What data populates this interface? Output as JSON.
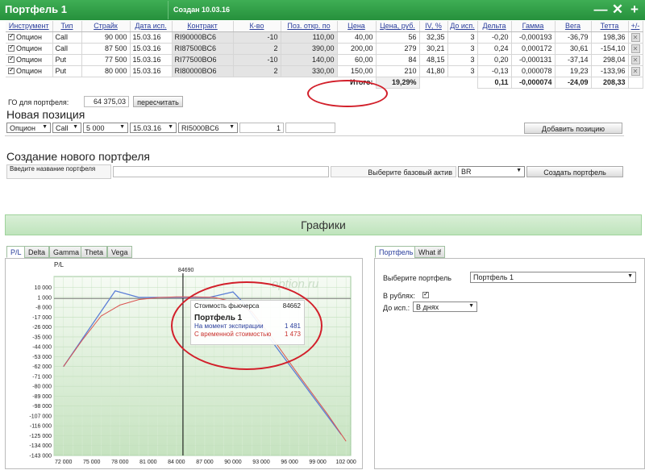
{
  "window": {
    "title": "Портфель 1",
    "created": "Создан 10.03.16",
    "minimize": "—",
    "close": "✕",
    "add": "+"
  },
  "positions_table": {
    "headers": [
      "Инструмент",
      "Тип",
      "Страйк",
      "Дата исп.",
      "Контракт",
      "К-во",
      "Поз. откр. по",
      "Цена",
      "Цена, руб.",
      "IV, %",
      "До исп.",
      "Дельта",
      "Гамма",
      "Вега",
      "Тетта",
      "+/-"
    ],
    "rows": [
      [
        "Опцион",
        "Call",
        "90 000",
        "15.03.16",
        "RI90000BC6",
        "-10",
        "110,00",
        "40,00",
        "56",
        "32,35",
        "3",
        "-0,20",
        "-0,000193",
        "-36,79",
        "198,36"
      ],
      [
        "Опцион",
        "Call",
        "87 500",
        "15.03.16",
        "RI87500BC6",
        "2",
        "390,00",
        "200,00",
        "279",
        "30,21",
        "3",
        "0,24",
        "0,000172",
        "30,61",
        "-154,10"
      ],
      [
        "Опцион",
        "Put",
        "77 500",
        "15.03.16",
        "RI77500BO6",
        "-10",
        "140,00",
        "60,00",
        "84",
        "48,15",
        "3",
        "0,20",
        "-0,000131",
        "-37,14",
        "298,04"
      ],
      [
        "Опцион",
        "Put",
        "80 000",
        "15.03.16",
        "RI80000BO6",
        "2",
        "330,00",
        "150,00",
        "210",
        "41,80",
        "3",
        "-0,13",
        "0,000078",
        "19,23",
        "-133,96"
      ]
    ],
    "totals": {
      "label": "Итого:",
      "percent": "19,29%",
      "delta": "0,11",
      "gamma": "-0,000074",
      "vega": "-24,09",
      "theta": "208,33"
    }
  },
  "go": {
    "label": "ГО для портфеля:",
    "value": "64 375,03",
    "recalc_button": "пересчитать"
  },
  "new_position": {
    "heading": "Новая позиция",
    "instrument": "Опцион",
    "type": "Call",
    "strike": "5 000",
    "date": "15.03.16",
    "contract": "RI5000BC6",
    "quantity": "1",
    "add_button": "Добавить позицию"
  },
  "new_portfolio": {
    "heading": "Создание нового портфеля",
    "name_label": "Введите название портфеля",
    "asset_label": "Выберите базовый актив",
    "asset_value": "BR",
    "create_button": "Создать портфель"
  },
  "graphs": {
    "title": "Графики",
    "tabs": [
      "P/L",
      "Delta",
      "Gamma",
      "Theta",
      "Vega"
    ],
    "right_tabs": [
      "Портфель",
      "What if"
    ]
  },
  "options": {
    "portfolio_label": "Выберите портфель",
    "portfolio_value": "Портфель 1",
    "rub_label": "В рублях:",
    "until_label": "До исп.:",
    "until_value": "В днях"
  },
  "tooltip": {
    "futures_label": "Стоимость фьючерса",
    "futures_value": "84662",
    "portfolio": "Портфель 1",
    "expiry_label": "На момент экспирации",
    "expiry_value": "1 481",
    "time_label": "С временной стоимостью",
    "time_value": "1 473"
  },
  "colors": {
    "expiry_line": "#5b7ed6",
    "time_line": "#d9534f",
    "header_green": "#2a9a42",
    "annotation": "#d21f2a"
  },
  "chart_data": {
    "type": "line",
    "ylabel": "P/L",
    "marker_label": "84690",
    "watermark": "option.ru",
    "xlim": [
      71000,
      102500
    ],
    "ylim": [
      -143000,
      20000
    ],
    "yticks": [
      10000,
      1000,
      -8000,
      -17000,
      -26000,
      -35000,
      -44000,
      -53000,
      -62000,
      -71000,
      -80000,
      -89000,
      -98000,
      -107000,
      -116000,
      -125000,
      -134000,
      -143000
    ],
    "ytick_labels": [
      "10 000",
      "1 000",
      "-8 000",
      "-17 000",
      "-26 000",
      "-35 000",
      "-44 000",
      "-53 000",
      "-62 000",
      "-71 000",
      "-80 000",
      "-89 000",
      "-98 000",
      "-107 000",
      "-116 000",
      "-125 000",
      "-134 000",
      "-143 000"
    ],
    "xticks": [
      72000,
      75000,
      78000,
      81000,
      84000,
      87000,
      90000,
      93000,
      96000,
      99000,
      102000
    ],
    "xtick_labels": [
      "72 000",
      "75 000",
      "78 000",
      "81 000",
      "84 000",
      "87 000",
      "90 000",
      "93 000",
      "96 000",
      "99 000",
      "102 000"
    ],
    "marker_x": 84690,
    "series": [
      {
        "name": "На момент экспирации",
        "x": [
          72000,
          77500,
          80000,
          87500,
          90000,
          91000,
          101500
        ],
        "y": [
          -62000,
          7000,
          1000,
          1000,
          6000,
          -3000,
          -124000
        ]
      },
      {
        "name": "С временной стоимостью",
        "x": [
          72000,
          74000,
          76000,
          78000,
          80000,
          82000,
          84000,
          86000,
          88000,
          90000,
          92000,
          94000,
          97000,
          100000,
          102000
        ],
        "y": [
          -62000,
          -38000,
          -16000,
          -6000,
          -1000,
          800,
          1400,
          1500,
          1000,
          -3000,
          -12000,
          -34000,
          -70000,
          -105000,
          -130000
        ]
      }
    ]
  }
}
